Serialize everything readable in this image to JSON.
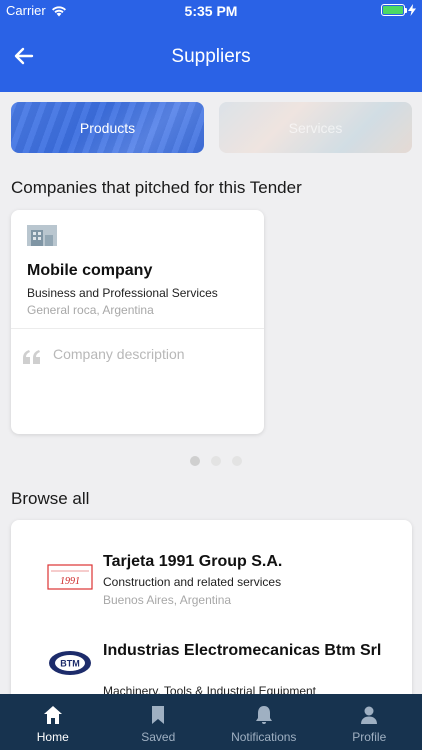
{
  "status_bar": {
    "carrier": "Carrier",
    "time": "5:35 PM"
  },
  "header": {
    "title": "Suppliers",
    "back_icon": "arrow-left-icon"
  },
  "segments": [
    {
      "label": "Products",
      "selected": true
    },
    {
      "label": "Services",
      "selected": false
    }
  ],
  "pitched": {
    "title": "Companies that pitched for this Tender",
    "card": {
      "name": "Mobile company",
      "category": "Business and Professional Services",
      "location": "General roca, Argentina",
      "description_placeholder": "Company description"
    },
    "page_count": 3,
    "active_page": 1
  },
  "browse": {
    "title": "Browse all",
    "suppliers": [
      {
        "name": "Tarjeta 1991 Group S.A.",
        "category": "Construction and related services",
        "location": "Buenos Aires, Argentina",
        "logo_text": "1991"
      },
      {
        "name": "Industrias Electromecanicas Btm Srl",
        "category": "Machinery, Tools & Industrial Equipment",
        "location": "",
        "logo_text": "BTM"
      }
    ]
  },
  "tab_bar": {
    "tabs": [
      {
        "label": "Home",
        "icon": "home-icon",
        "active": true
      },
      {
        "label": "Saved",
        "icon": "bookmark-icon",
        "active": false
      },
      {
        "label": "Notifications",
        "icon": "bell-icon",
        "active": false
      },
      {
        "label": "Profile",
        "icon": "person-icon",
        "active": false
      }
    ]
  },
  "colors": {
    "primary": "#2a62e6",
    "tab_bar": "#17334f",
    "background": "#efeff1"
  }
}
